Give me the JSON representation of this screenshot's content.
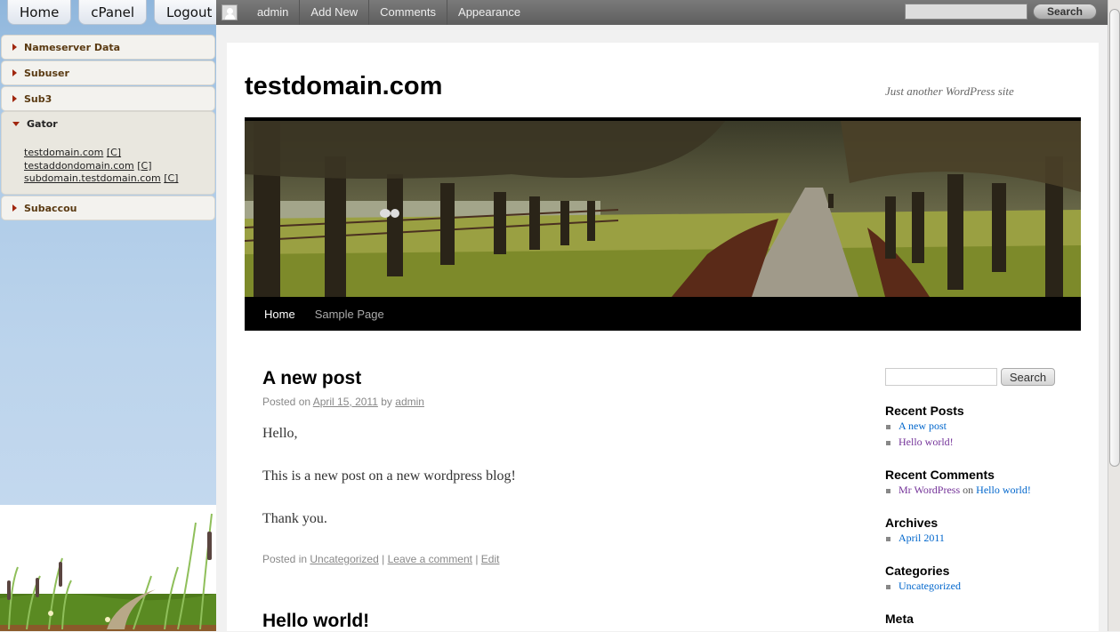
{
  "cpanel": {
    "buttons": [
      "Home",
      "cPanel",
      "Logout"
    ],
    "sections": [
      {
        "label": "Nameserver Data",
        "open": false
      },
      {
        "label": "Subuser",
        "open": false
      },
      {
        "label": "Sub3",
        "open": false
      },
      {
        "label": "Gator",
        "open": true,
        "links": [
          {
            "domain": "testdomain.com",
            "c": "[C]"
          },
          {
            "domain": "testaddondomain.com",
            "c": "[C]"
          },
          {
            "domain": "subdomain.testdomain.com",
            "c": "[C]"
          }
        ]
      },
      {
        "label": "Subaccou",
        "open": false
      }
    ]
  },
  "adminbar": {
    "items": [
      "admin",
      "Add New",
      "Comments",
      "Appearance"
    ],
    "search_button": "Search",
    "search_value": ""
  },
  "site": {
    "title": "testdomain.com",
    "tagline": "Just another WordPress site",
    "nav": [
      "Home",
      "Sample Page"
    ]
  },
  "posts": [
    {
      "title": "A new post",
      "posted_on": "Posted on",
      "date": "April 15, 2011",
      "by": "by",
      "author": "admin",
      "paragraphs": [
        "Hello,",
        "This is a new post on a new wordpress blog!",
        "Thank you."
      ],
      "footer": {
        "posted_in": "Posted in",
        "category": "Uncategorized",
        "sep": "|",
        "comment": "Leave a comment",
        "edit": "Edit"
      }
    },
    {
      "title": "Hello world!"
    }
  ],
  "sidebar": {
    "search_button": "Search",
    "search_value": "",
    "recent_posts_title": "Recent Posts",
    "recent_posts": [
      "A new post",
      "Hello world!"
    ],
    "recent_comments_title": "Recent Comments",
    "recent_comment": {
      "author": "Mr WordPress",
      "on": "on",
      "post": "Hello world!"
    },
    "archives_title": "Archives",
    "archives": [
      "April 2011"
    ],
    "categories_title": "Categories",
    "categories": [
      "Uncategorized"
    ],
    "meta_title": "Meta"
  }
}
